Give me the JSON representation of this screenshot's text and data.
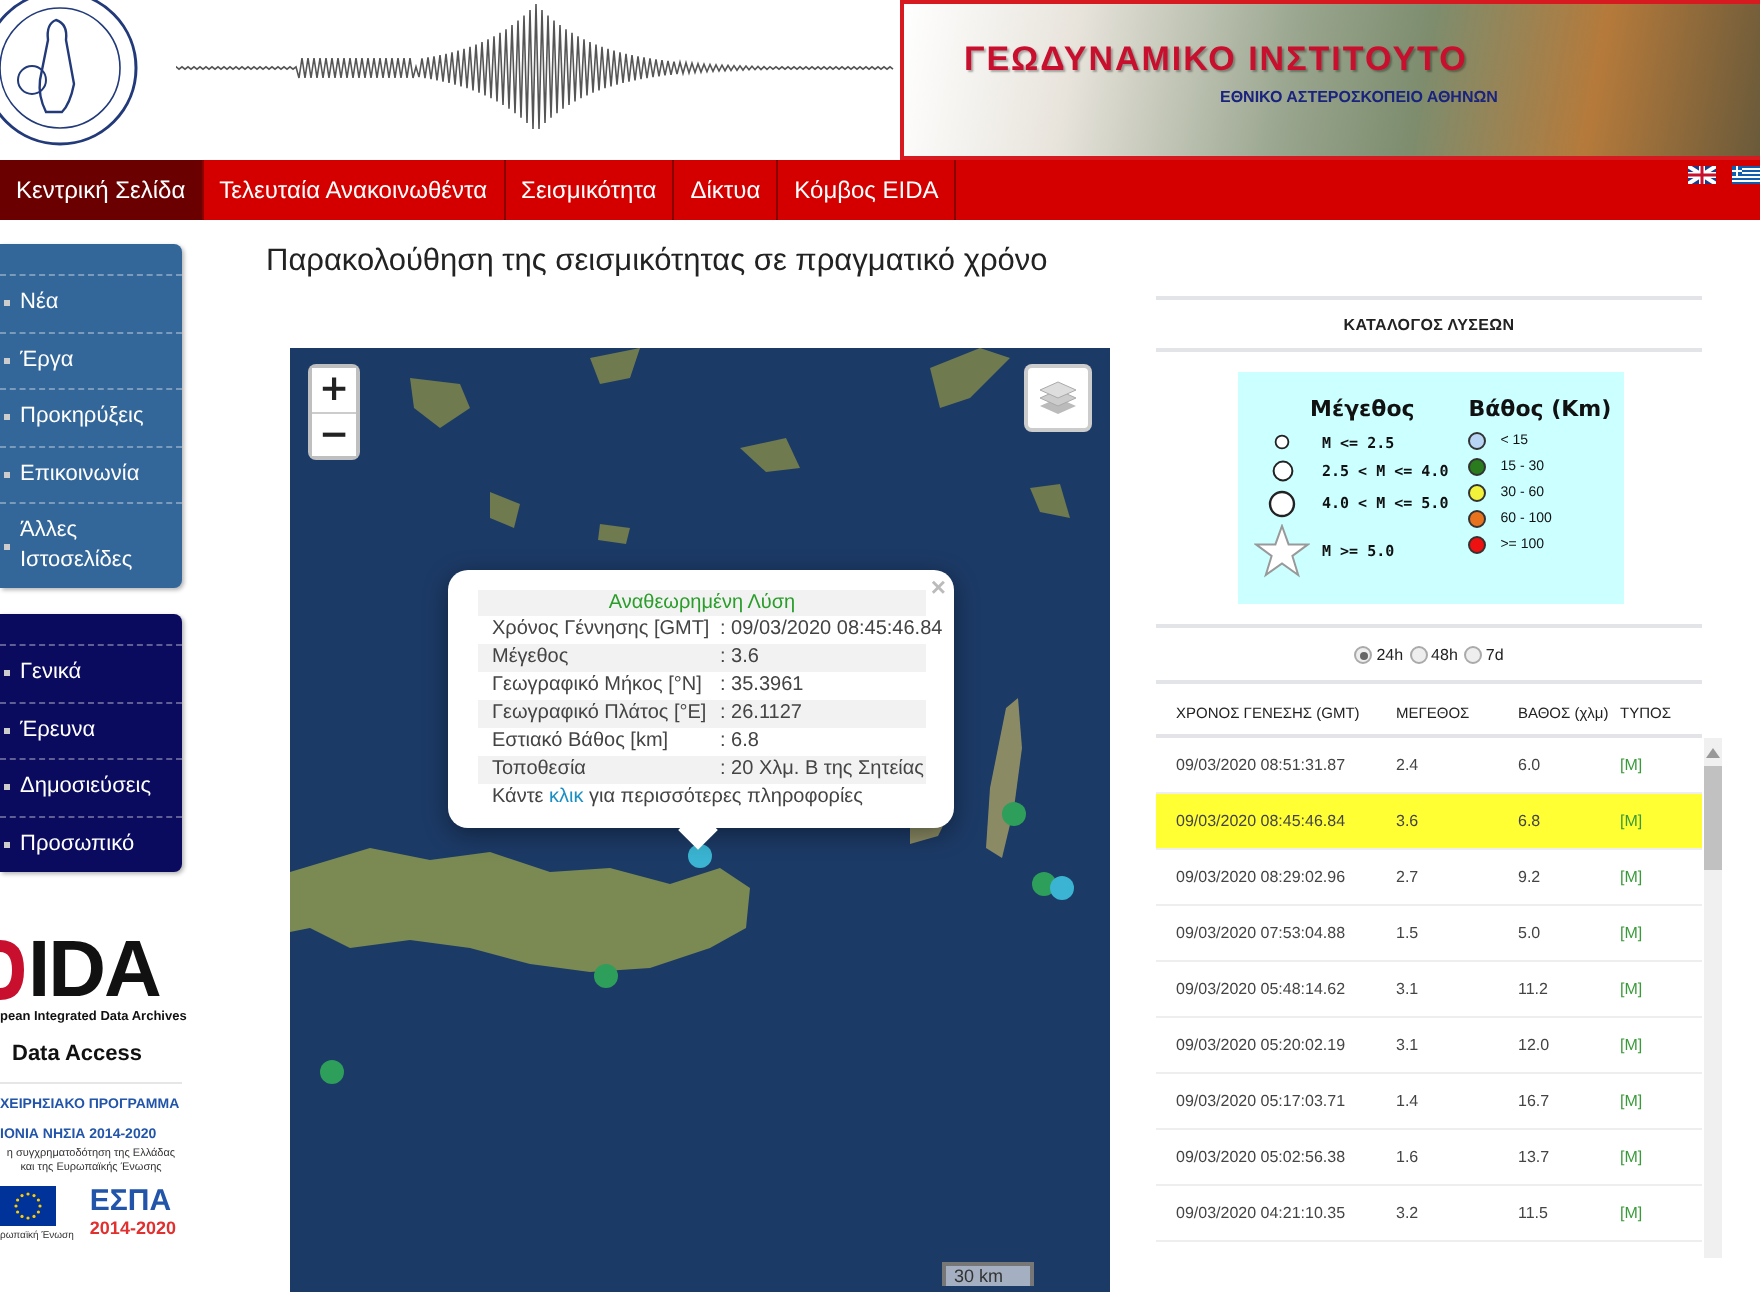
{
  "header": {
    "title": "ΓΕΩΔΥΝΑΜΙΚΟ ΙΝΣΤΙΤΟΥΤΟ",
    "subtitle": "ΕΘΝΙΚΟ ΑΣΤΕΡΟΣΚΟΠΕΙΟ ΑΘΗΝΩΝ"
  },
  "nav": [
    {
      "label": "Κεντρική Σελίδα",
      "selected": true
    },
    {
      "label": "Τελευταία Ανακοινωθέντα",
      "selected": false
    },
    {
      "label": "Σεισμικότητα",
      "selected": false
    },
    {
      "label": "Δίκτυα",
      "selected": false
    },
    {
      "label": "Κόμβος EIDA",
      "selected": false
    }
  ],
  "sidebar": {
    "menus": [
      {
        "color": "#336699",
        "items": [
          "Νέα",
          "Έργα",
          "Προκηρύξεις",
          "Επικοινωνία",
          "Άλλες Ιστοσελίδες"
        ]
      },
      {
        "color": "#0a0a5e",
        "items": [
          "Γενικά",
          "Έρευνα",
          "Δημοσιεύσεις",
          "Προσωπικό"
        ]
      }
    ],
    "eida": {
      "logo": "IDA",
      "tagline": "pean Integrated Data Archives",
      "caption": "Data Access"
    },
    "espa": {
      "program": "ΧΕΙΡΗΣΙΑΚΟ ΠΡΟΓΡΑΜΜΑ",
      "region": "ΙΟΝΙΑ ΝΗΣΙΑ 2014-2020",
      "note": "η συγχρηματοδότηση της Ελλάδας και της Ευρωπαϊκής Ένωσης",
      "eu": "ρωπαϊκή Ένωση",
      "logo": "ΕΣΠΑ",
      "years": "2014-2020"
    }
  },
  "page_title": "Παρακολούθηση της σεισμικότητας σε πραγματικό χρόνο",
  "map": {
    "zoom_in": "+",
    "zoom_out": "−",
    "scale": "30 km",
    "markers": [
      {
        "color": "#3ab4d2"
      },
      {
        "color": "#2e9e5b"
      },
      {
        "color": "#2e9e5b"
      },
      {
        "color": "#3ab4d2"
      },
      {
        "color": "#2e9e5b"
      },
      {
        "color": "#2e9e5b"
      }
    ],
    "popup": {
      "close": "×",
      "title": "Αναθεωρημένη Λύση",
      "rows": [
        {
          "label": "Χρόνος Γέννησης [GMT]",
          "value": ": 09/03/2020 08:45:46.84"
        },
        {
          "label": "Μέγεθος",
          "value": ": 3.6"
        },
        {
          "label": "Γεωγραφικό Μήκος [°N]",
          "value": ": 35.3961"
        },
        {
          "label": "Γεωγραφικό Πλάτος [°E]",
          "value": ": 26.1127"
        },
        {
          "label": "Εστιακό Βάθος [km]",
          "value": ": 6.8"
        },
        {
          "label": "Τοποθεσία",
          "value": ": 20 Χλμ. Β της Σητείας"
        }
      ],
      "footer": {
        "before": "Κάντε ",
        "link": "κλικ",
        "after": " για περισσότερες πληροφορίες"
      }
    }
  },
  "catalog": {
    "title": "ΚΑΤΑΛΟΓΟΣ ΛΥΣΕΩΝ",
    "legend": {
      "magnitude_title": "Μέγεθος",
      "depth_title": "Βάθος (Km)",
      "magnitudes": [
        {
          "kind": "small",
          "label": "M <= 2.5"
        },
        {
          "kind": "medium",
          "label": "2.5 < M <= 4.0"
        },
        {
          "kind": "large",
          "label": "4.0 < M <= 5.0"
        },
        {
          "kind": "star",
          "label": "M >= 5.0"
        }
      ],
      "depths": [
        {
          "label": "< 15",
          "color": "#b8d4f5"
        },
        {
          "label": "15 - 30",
          "color": "#2a7a1e"
        },
        {
          "label": "30 - 60",
          "color": "#f2f23a"
        },
        {
          "label": "60 - 100",
          "color": "#e8731e"
        },
        {
          "label": ">= 100",
          "color": "#ee1111"
        }
      ]
    },
    "periods": [
      {
        "label": "24h",
        "selected": true
      },
      {
        "label": "48h",
        "selected": false
      },
      {
        "label": "7d",
        "selected": false
      }
    ],
    "columns": [
      "ΧΡΟΝΟΣ ΓΕΝΕΣΗΣ (GMT)",
      "ΜΕΓΕΘΟΣ",
      "ΒΑΘΟΣ (χλμ)",
      "ΤΥΠΟΣ"
    ],
    "rows": [
      {
        "time": "09/03/2020 08:51:31.87",
        "mag": "2.4",
        "depth": "6.0",
        "type": "[M]",
        "selected": false
      },
      {
        "time": "09/03/2020 08:45:46.84",
        "mag": "3.6",
        "depth": "6.8",
        "type": "[M]",
        "selected": true
      },
      {
        "time": "09/03/2020 08:29:02.96",
        "mag": "2.7",
        "depth": "9.2",
        "type": "[M]",
        "selected": false
      },
      {
        "time": "09/03/2020 07:53:04.88",
        "mag": "1.5",
        "depth": "5.0",
        "type": "[M]",
        "selected": false
      },
      {
        "time": "09/03/2020 05:48:14.62",
        "mag": "3.1",
        "depth": "11.2",
        "type": "[M]",
        "selected": false
      },
      {
        "time": "09/03/2020 05:20:02.19",
        "mag": "3.1",
        "depth": "12.0",
        "type": "[M]",
        "selected": false
      },
      {
        "time": "09/03/2020 05:17:03.71",
        "mag": "1.4",
        "depth": "16.7",
        "type": "[M]",
        "selected": false
      },
      {
        "time": "09/03/2020 05:02:56.38",
        "mag": "1.6",
        "depth": "13.7",
        "type": "[M]",
        "selected": false
      },
      {
        "time": "09/03/2020 04:21:10.35",
        "mag": "3.2",
        "depth": "11.5",
        "type": "[M]",
        "selected": false
      }
    ]
  }
}
